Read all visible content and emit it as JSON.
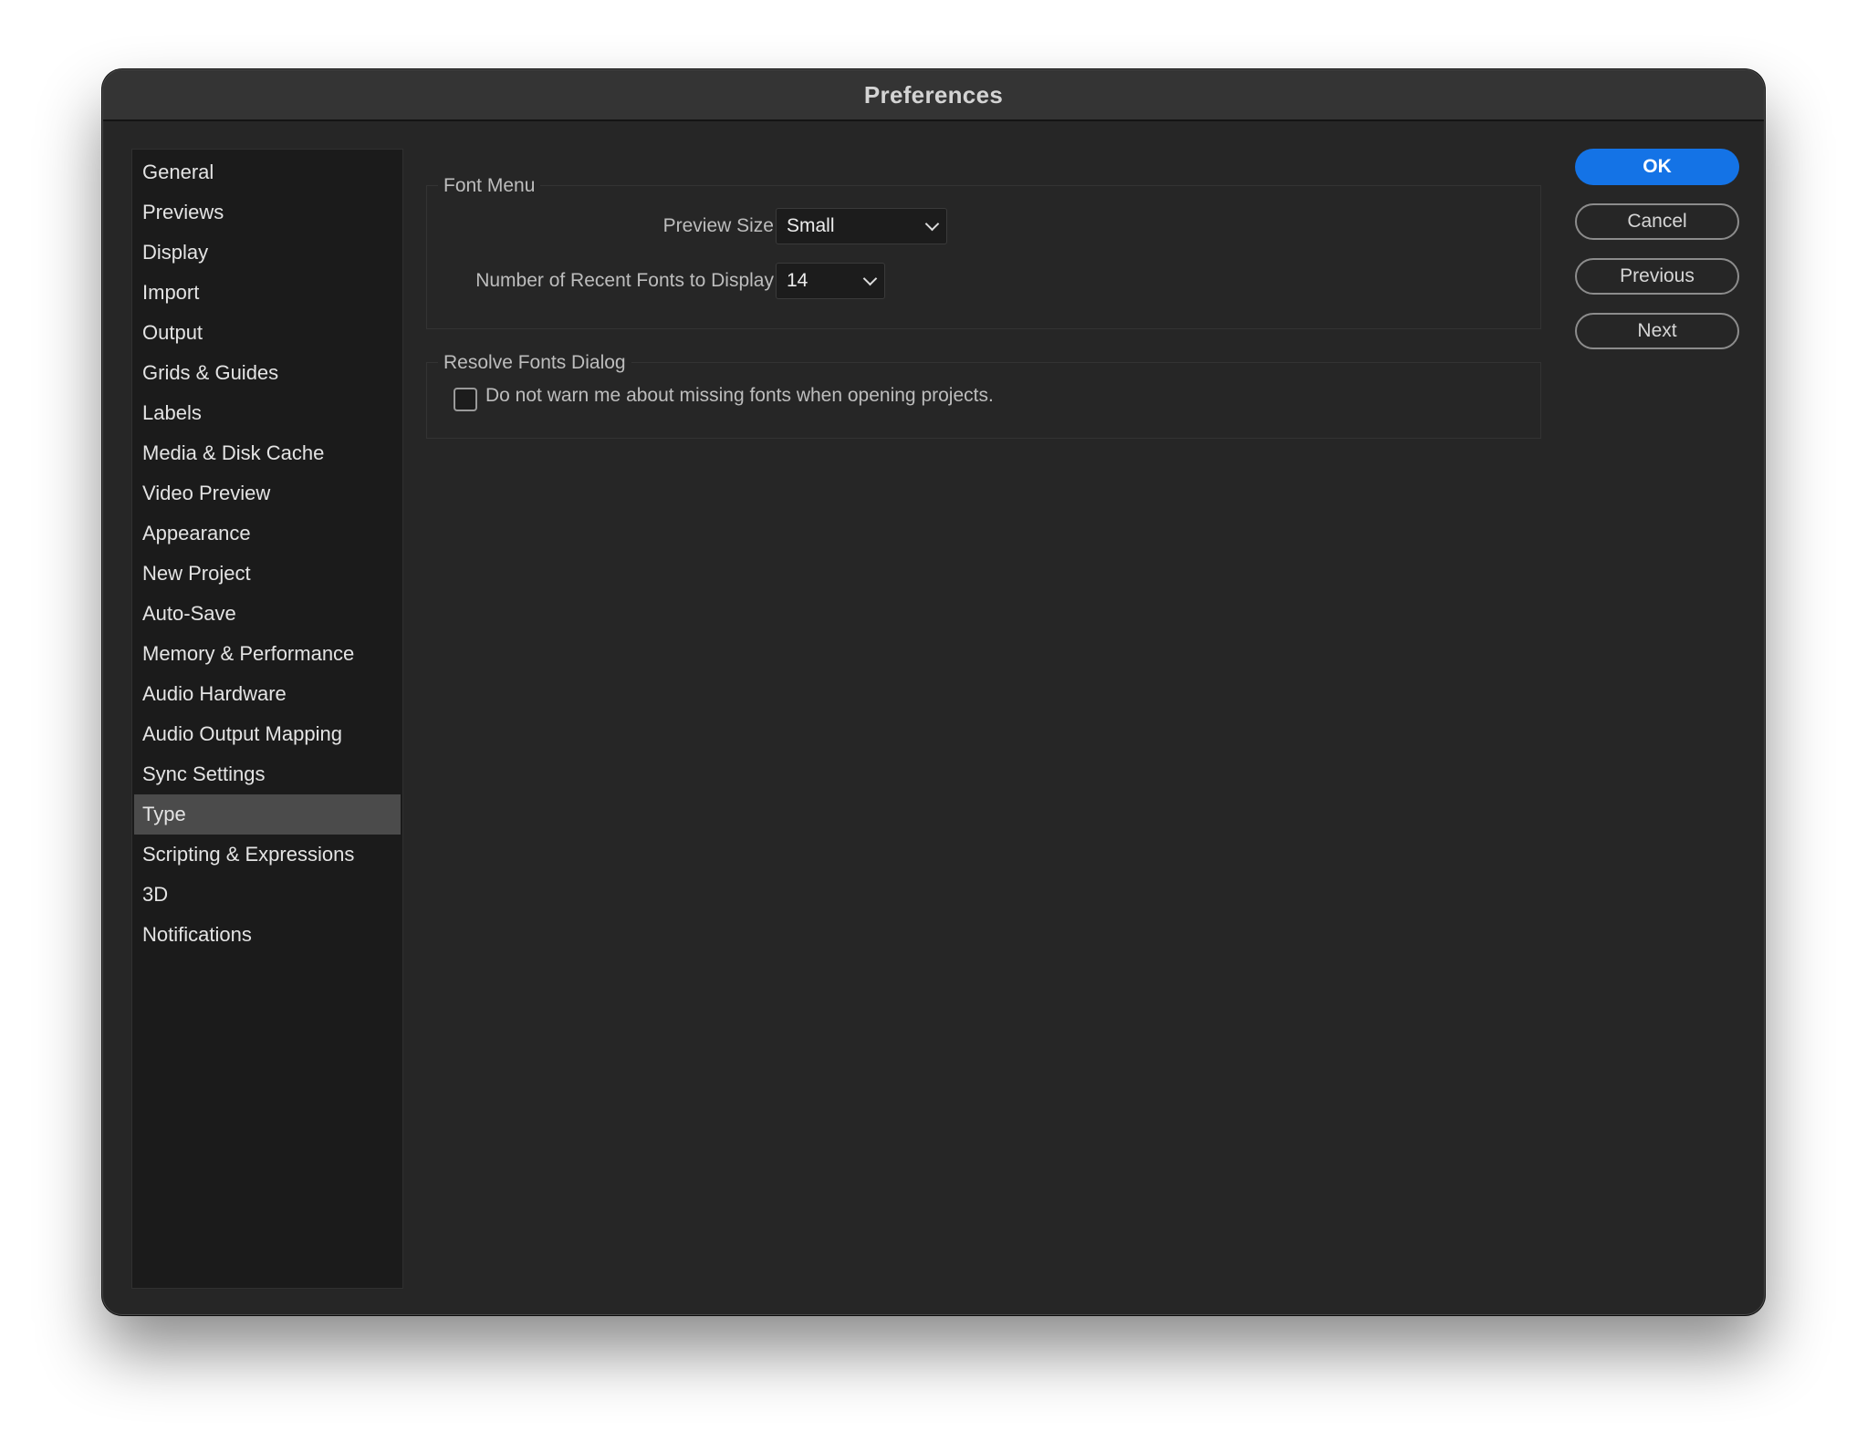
{
  "window": {
    "title": "Preferences"
  },
  "sidebar": {
    "items": [
      {
        "label": "General"
      },
      {
        "label": "Previews"
      },
      {
        "label": "Display"
      },
      {
        "label": "Import"
      },
      {
        "label": "Output"
      },
      {
        "label": "Grids & Guides"
      },
      {
        "label": "Labels"
      },
      {
        "label": "Media & Disk Cache"
      },
      {
        "label": "Video Preview"
      },
      {
        "label": "Appearance"
      },
      {
        "label": "New Project"
      },
      {
        "label": "Auto-Save"
      },
      {
        "label": "Memory & Performance"
      },
      {
        "label": "Audio Hardware"
      },
      {
        "label": "Audio Output Mapping"
      },
      {
        "label": "Sync Settings"
      },
      {
        "label": "Type"
      },
      {
        "label": "Scripting & Expressions"
      },
      {
        "label": "3D"
      },
      {
        "label": "Notifications"
      }
    ],
    "selected": "Type"
  },
  "font_menu": {
    "legend": "Font Menu",
    "preview_size_label": "Preview Size",
    "preview_size_value": "Small",
    "recent_fonts_label": "Number of Recent Fonts to Display",
    "recent_fonts_value": "14"
  },
  "resolve_fonts": {
    "legend": "Resolve Fonts Dialog",
    "checkbox_label": "Do not warn me about missing fonts when opening projects.",
    "checkbox_checked": false
  },
  "buttons": {
    "ok": "OK",
    "cancel": "Cancel",
    "previous": "Previous",
    "next": "Next"
  },
  "colors": {
    "accent": "#1473e6",
    "window_bg": "#262626",
    "sidebar_bg": "#1b1b1b",
    "selected_bg": "#4b4b4b"
  }
}
